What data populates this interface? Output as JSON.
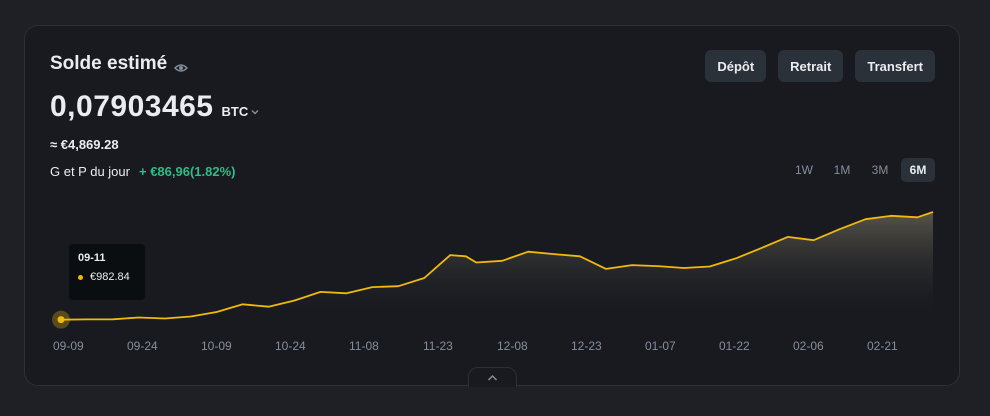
{
  "balance": {
    "title": "Solde estimé",
    "amount": "0,07903465",
    "unit": "BTC",
    "fiat": "≈ €4,869.28"
  },
  "pnl": {
    "label": "G et P du jour",
    "value": "+ €86,96(1.82%)"
  },
  "actions": {
    "deposit": "Dépôt",
    "withdraw": "Retrait",
    "transfer": "Transfert"
  },
  "ranges": [
    "1W",
    "1M",
    "3M",
    "6M"
  ],
  "active_range": "6M",
  "tooltip": {
    "date": "09-11",
    "value": "€982.84"
  },
  "colors": {
    "line": "#f0b90b",
    "positive": "#2ebd85",
    "background": "#181a20"
  },
  "icons": {
    "visibility": "eye-icon",
    "unit_dropdown": "chevron-down-icon",
    "collapse": "chevron-up-icon"
  },
  "chart_data": {
    "type": "area",
    "x_ticks": [
      "09-09",
      "09-24",
      "10-09",
      "10-24",
      "11-08",
      "11-23",
      "12-08",
      "12-23",
      "01-07",
      "01-22",
      "02-06",
      "02-21"
    ],
    "series": [
      {
        "x": [
          0,
          5,
          10,
          15,
          20,
          25,
          30,
          35,
          40,
          45,
          50,
          55,
          60,
          65,
          70,
          73,
          75,
          78,
          80,
          85,
          90,
          95,
          100,
          105,
          110,
          115,
          120,
          125,
          130,
          135,
          140,
          145,
          150,
          155,
          160,
          165,
          168
        ],
        "values": [
          980,
          985,
          988,
          1025,
          1005,
          1045,
          1140,
          1300,
          1250,
          1380,
          1560,
          1530,
          1660,
          1680,
          1850,
          2140,
          2330,
          2305,
          2175,
          2210,
          2400,
          2350,
          2305,
          2040,
          2120,
          2100,
          2060,
          2090,
          2260,
          2480,
          2710,
          2640,
          2870,
          3080,
          3150,
          3120,
          3230
        ]
      }
    ]
  }
}
